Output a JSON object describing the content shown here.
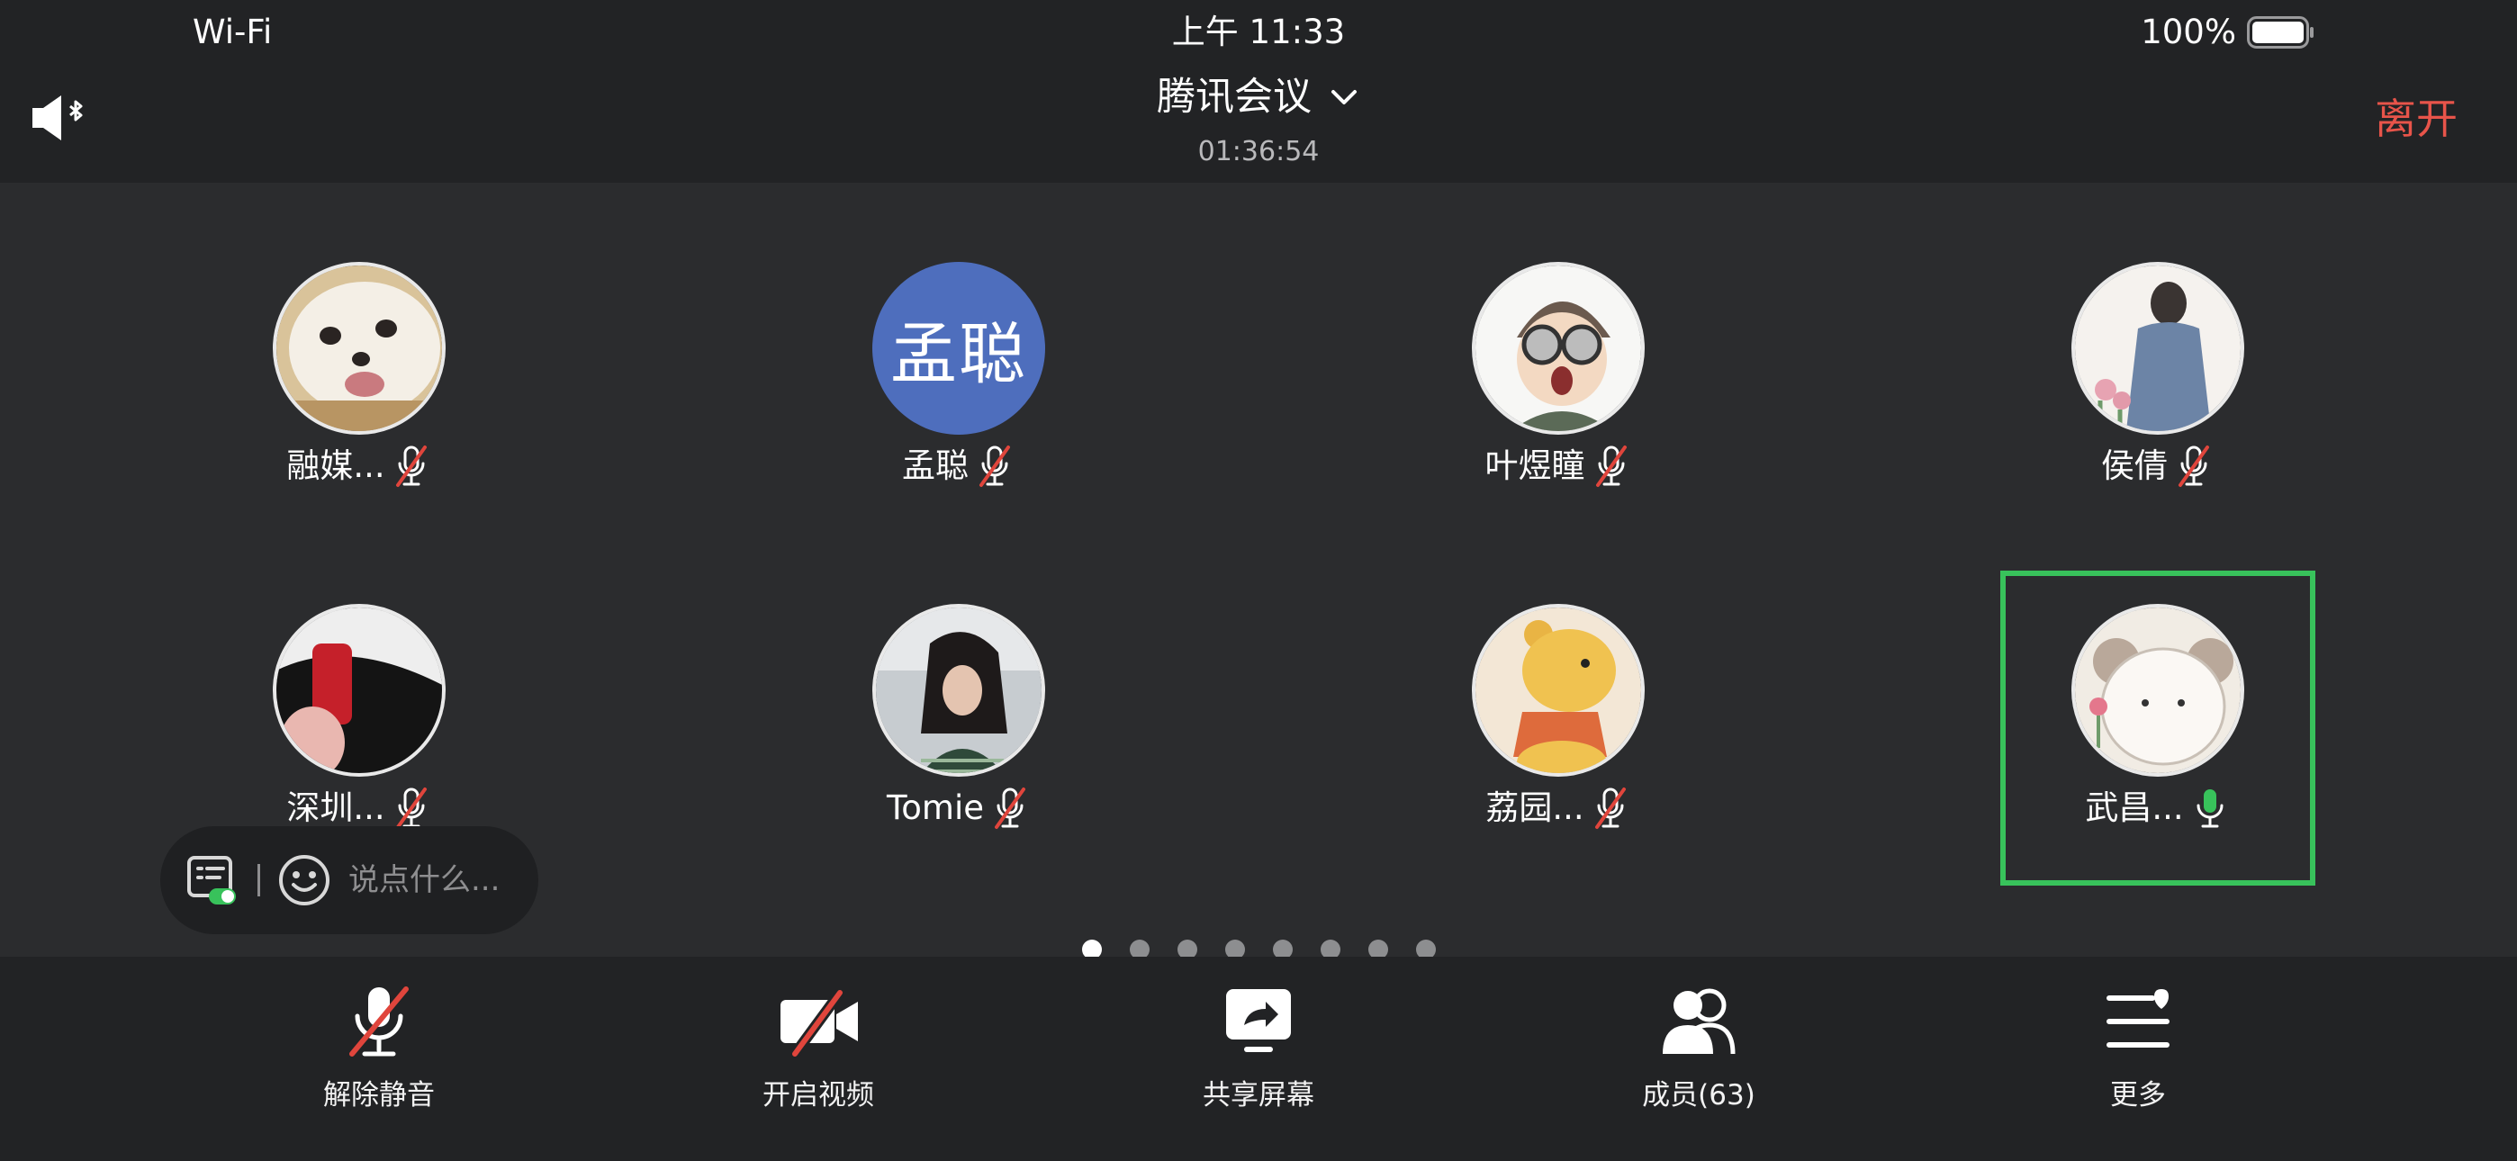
{
  "status_bar": {
    "network": "Wi-Fi",
    "time": "上午 11:33",
    "battery": "100%"
  },
  "header": {
    "title": "腾讯会议",
    "timer": "01:36:54",
    "leave_label": "离开"
  },
  "participants": [
    {
      "name": "融媒...",
      "avatar": "pomeranian-photo",
      "muted": true
    },
    {
      "name": "孟聪",
      "avatar_initials": "孟聪",
      "muted": true
    },
    {
      "name": "叶煜瞳",
      "avatar": "cartoon-goggles-boy",
      "muted": true
    },
    {
      "name": "侯倩",
      "avatar": "illustrated-girl-denim",
      "muted": true
    },
    {
      "name": "深圳...",
      "avatar": "red-black-photo",
      "muted": true
    },
    {
      "name": "Tomie",
      "avatar": "girl-photo",
      "muted": true
    },
    {
      "name": "荔园...",
      "avatar": "winnie-the-pooh",
      "muted": true
    },
    {
      "name": "武昌...",
      "avatar": "cartoon-bear-flower",
      "muted": false,
      "speaking": true
    }
  ],
  "chat": {
    "placeholder": "说点什么..."
  },
  "pagination": {
    "pages": 8,
    "current": 1
  },
  "toolbar": {
    "unmute": "解除静音",
    "start_video": "开启视频",
    "share_screen": "共享屏幕",
    "members": "成员(63)",
    "more": "更多"
  },
  "colors": {
    "leave": "#e8544a",
    "speaking_border": "#38c25b",
    "initials_bg": "#4e6ebd",
    "mute_slash": "#e0453c"
  }
}
